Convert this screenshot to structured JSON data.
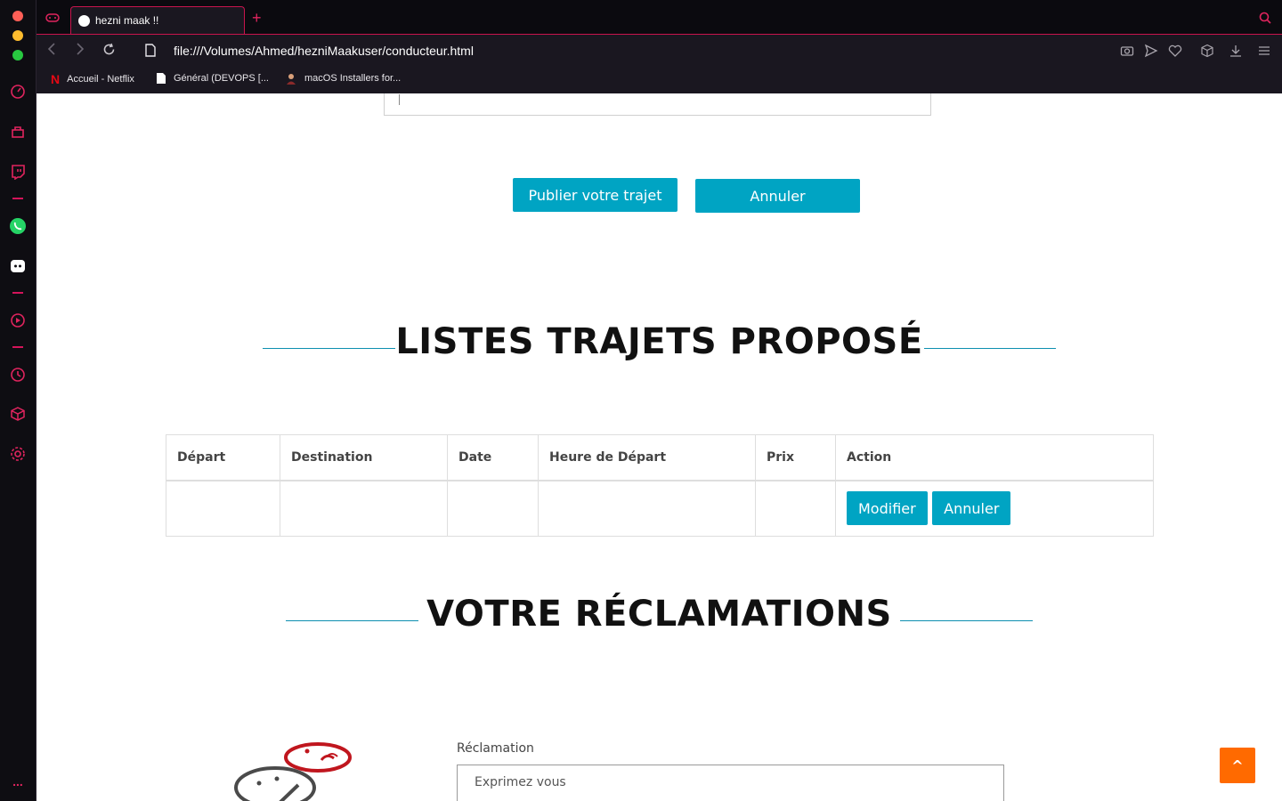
{
  "browser": {
    "tab_title": "hezni maak !!",
    "new_tab_symbol": "+",
    "url": "file:///Volumes/Ahmed/hezniMaakuser/conducteur.html",
    "bookmarks": [
      {
        "label": "Accueil - Netflix"
      },
      {
        "label": "Général (DEVOPS [..."
      },
      {
        "label": "macOS Installers for..."
      }
    ],
    "sidebar_more": "..."
  },
  "form": {
    "publish_label": "Publier votre trajet",
    "cancel_label": "Annuler"
  },
  "trips": {
    "title": "LISTES TRAJETS PROPOSÉ",
    "headers": [
      "Départ",
      "Destination",
      "Date",
      "Heure de Départ",
      "Prix",
      "Action"
    ],
    "row": {
      "modify_label": "Modifier",
      "cancel_label": "Annuler"
    }
  },
  "complaints": {
    "title": "VOTRE RÉCLAMATIONS",
    "field_label": "Réclamation",
    "placeholder": "Exprimez vous"
  },
  "scroll_top_label": "^",
  "colors": {
    "accent": "#00a4c3",
    "browser_accent": "#e0245e",
    "scroll_button": "#ff6a00"
  }
}
